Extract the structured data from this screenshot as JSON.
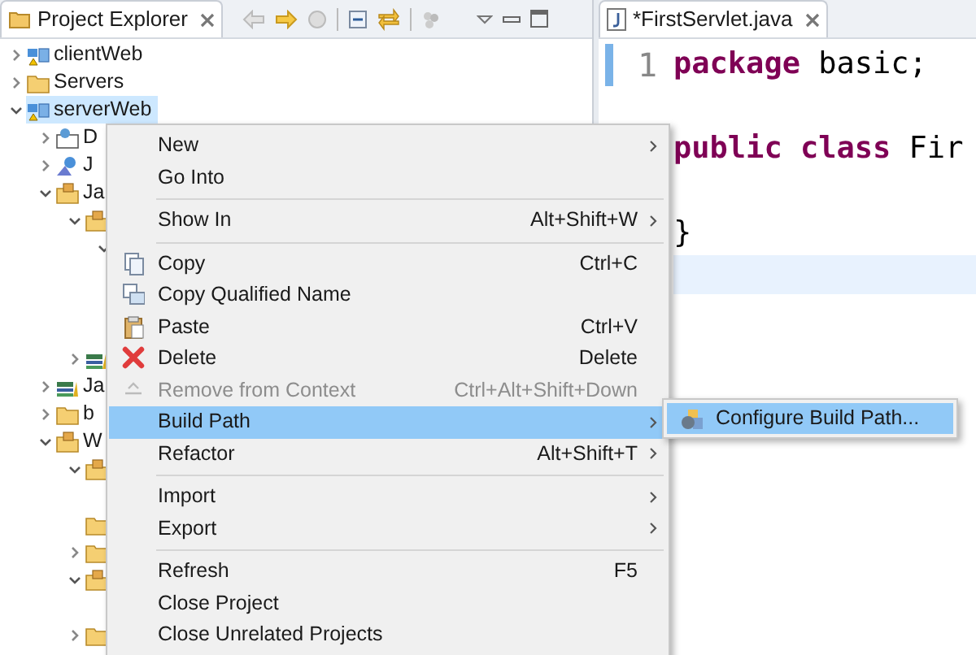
{
  "explorer": {
    "title": "Project Explorer",
    "tree": [
      {
        "label": "clientWeb",
        "kind": "project",
        "expanded": false,
        "selected": false
      },
      {
        "label": "Servers",
        "kind": "folder",
        "expanded": false,
        "selected": false
      },
      {
        "label": "serverWeb",
        "kind": "project",
        "expanded": true,
        "selected": true,
        "children": [
          {
            "label": "D",
            "kind": "descriptor",
            "expanded": false,
            "selected": false
          },
          {
            "label": "J",
            "kind": "service",
            "expanded": false,
            "selected": false
          },
          {
            "label": "Ja",
            "kind": "source",
            "expanded": true,
            "selected": false,
            "children": [
              {
                "kind": "package",
                "expanded": true,
                "selected": false,
                "children": [
                  {
                    "expanded": true
                  }
                ]
              },
              {
                "kind": "library",
                "expanded": false,
                "selected": false
              }
            ]
          },
          {
            "label": "Ja",
            "kind": "library",
            "expanded": false,
            "selected": false
          },
          {
            "label": "b",
            "kind": "folder",
            "expanded": false,
            "selected": false
          },
          {
            "label": "W",
            "kind": "source",
            "expanded": true,
            "selected": false,
            "children": [
              {
                "kind": "source",
                "expanded": true,
                "selected": false
              },
              {
                "kind": "folder",
                "selected": false
              },
              {
                "kind": "folder",
                "expanded": false,
                "selected": false
              },
              {
                "kind": "source",
                "expanded": true,
                "selected": false
              },
              {
                "kind": "folder",
                "expanded": false,
                "selected": false
              }
            ]
          }
        ]
      }
    ]
  },
  "editor": {
    "tab": {
      "title": "*FirstServlet.java"
    },
    "lines": [
      {
        "number": "1",
        "tokens": [
          {
            "text": "package",
            "kind": "keyword"
          },
          {
            "text": " basic;",
            "kind": "plain"
          }
        ]
      },
      {
        "tokens": [
          {
            "text": "public",
            "kind": "keyword"
          },
          {
            "text": " class",
            "kind": "keyword"
          },
          {
            "text": " Fir",
            "kind": "plain"
          }
        ]
      },
      {
        "tokens": [
          {
            "text": "}",
            "kind": "plain"
          }
        ]
      }
    ]
  },
  "context_menu": {
    "items": [
      {
        "kind": "item",
        "label": "New",
        "submenu": true,
        "disabled": false,
        "selected": false
      },
      {
        "kind": "item",
        "label": "Go Into",
        "submenu": false,
        "disabled": false,
        "selected": false
      },
      {
        "kind": "separator"
      },
      {
        "kind": "item",
        "label": "Show In",
        "shortcut": "Alt+Shift+W",
        "submenu": true,
        "disabled": false,
        "selected": false
      },
      {
        "kind": "separator"
      },
      {
        "kind": "item",
        "label": "Copy",
        "shortcut": "Ctrl+C",
        "submenu": false,
        "disabled": false,
        "selected": false
      },
      {
        "kind": "item",
        "label": "Copy Qualified Name",
        "submenu": false,
        "disabled": false,
        "selected": false
      },
      {
        "kind": "item",
        "label": "Paste",
        "shortcut": "Ctrl+V",
        "submenu": false,
        "disabled": false,
        "selected": false
      },
      {
        "kind": "item",
        "label": "Delete",
        "shortcut": "Delete",
        "submenu": false,
        "disabled": false,
        "selected": false
      },
      {
        "kind": "item",
        "label": "Remove from Context",
        "shortcut": "Ctrl+Alt+Shift+Down",
        "submenu": false,
        "disabled": true,
        "selected": false
      },
      {
        "kind": "item",
        "label": "Build Path",
        "submenu": true,
        "disabled": false,
        "selected": true
      },
      {
        "kind": "item",
        "label": "Refactor",
        "shortcut": "Alt+Shift+T",
        "submenu": true,
        "disabled": false,
        "selected": false
      },
      {
        "kind": "separator"
      },
      {
        "kind": "item",
        "label": "Import",
        "submenu": true,
        "disabled": false,
        "selected": false
      },
      {
        "kind": "item",
        "label": "Export",
        "submenu": true,
        "disabled": false,
        "selected": false
      },
      {
        "kind": "separator"
      },
      {
        "kind": "item",
        "label": "Refresh",
        "shortcut": "F5",
        "submenu": false,
        "disabled": false,
        "selected": false
      },
      {
        "kind": "item",
        "label": "Close Project",
        "submenu": false,
        "disabled": false,
        "selected": false
      },
      {
        "kind": "item",
        "label": "Close Unrelated Projects",
        "submenu": false,
        "disabled": false,
        "selected": false
      }
    ]
  },
  "submenu": {
    "items": [
      {
        "label": "Configure Build Path...",
        "selected": true
      }
    ]
  }
}
